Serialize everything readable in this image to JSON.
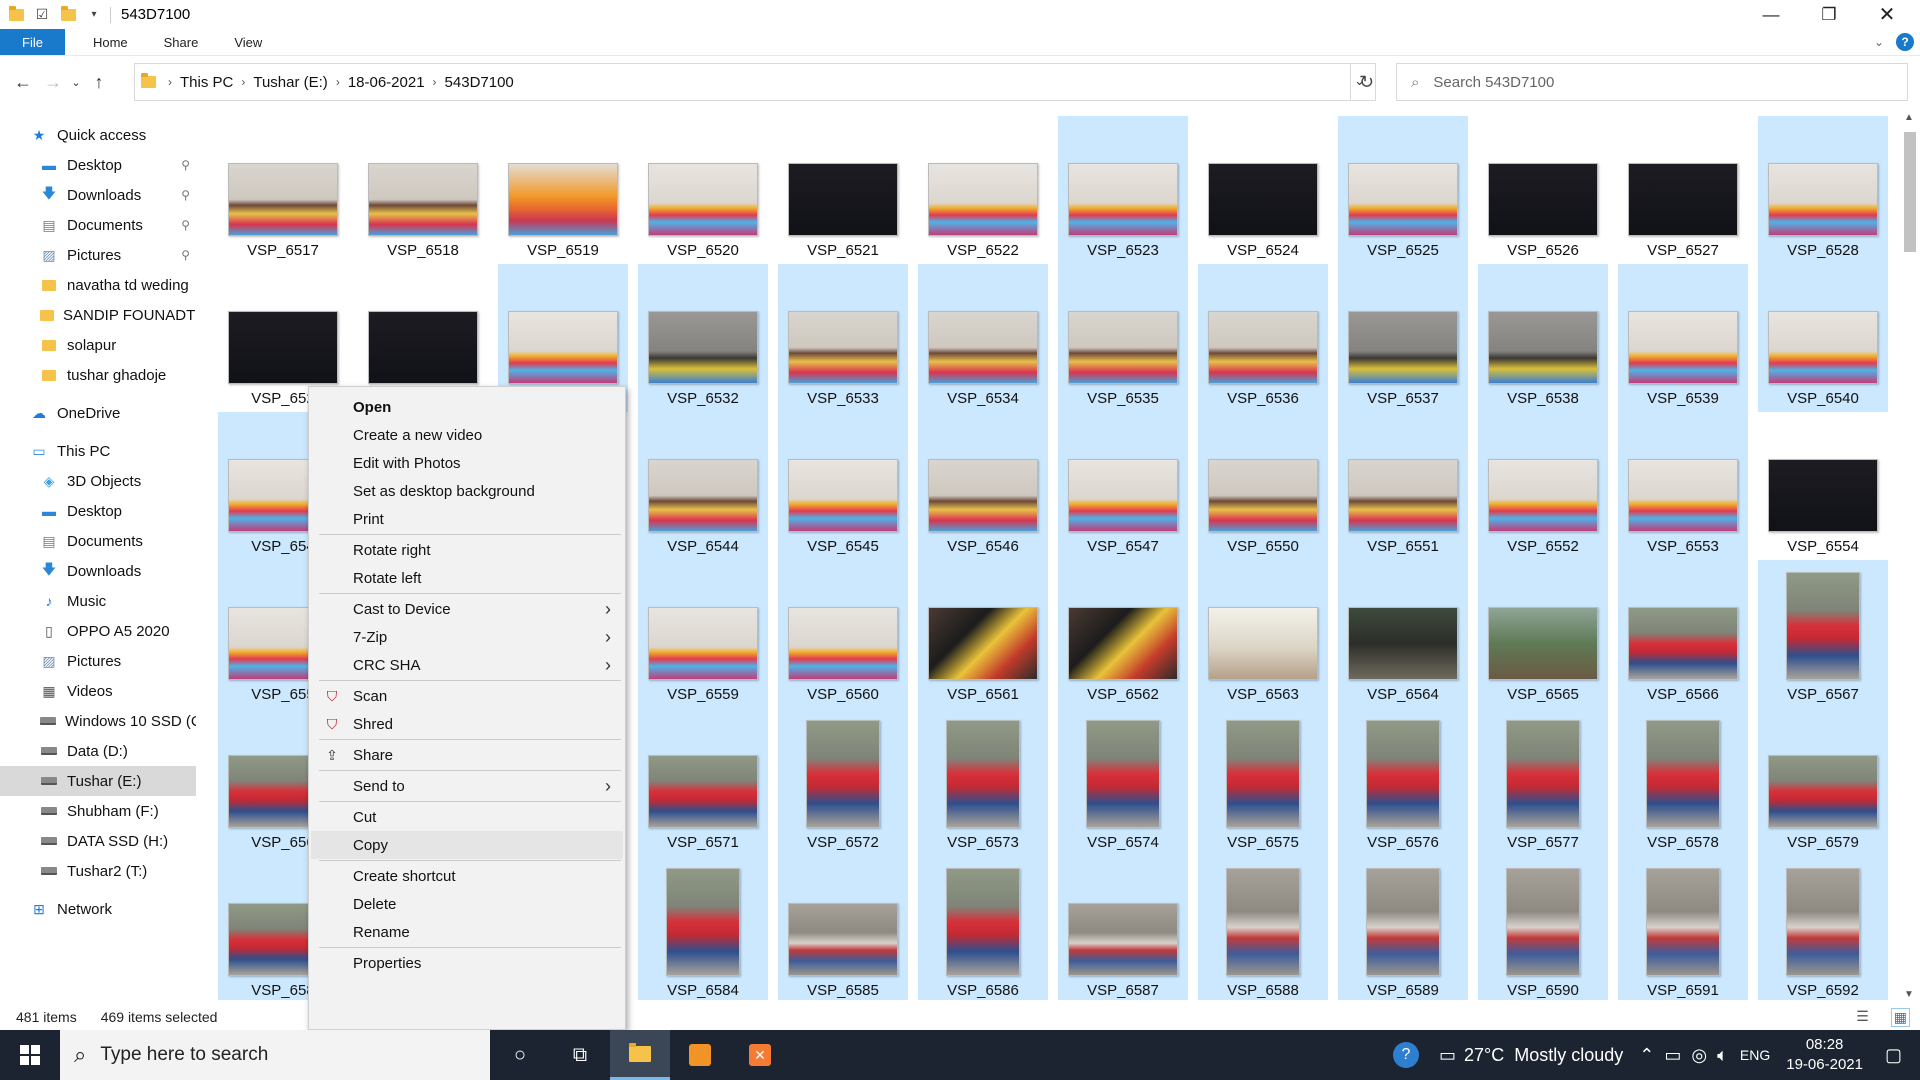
{
  "window": {
    "title": "543D7100"
  },
  "ribbon": {
    "tabs": [
      "File",
      "Home",
      "Share",
      "View"
    ],
    "help": "?"
  },
  "address": {
    "path": [
      "This PC",
      "Tushar (E:)",
      "18-06-2021",
      "543D7100"
    ],
    "search_placeholder": "Search 543D7100"
  },
  "sidebar": {
    "items": [
      {
        "label": "Quick access",
        "icon": "star-icon",
        "indent": 0
      },
      {
        "label": "Desktop",
        "icon": "desktop-icon",
        "indent": 1,
        "pinned": true
      },
      {
        "label": "Downloads",
        "icon": "download-arrow-icon",
        "indent": 1,
        "pinned": true
      },
      {
        "label": "Documents",
        "icon": "document-icon",
        "indent": 1,
        "pinned": true
      },
      {
        "label": "Pictures",
        "icon": "picture-icon",
        "indent": 1,
        "pinned": true
      },
      {
        "label": "navatha td weding",
        "icon": "folder-icon",
        "indent": 1
      },
      {
        "label": "SANDIP FOUNADTI(",
        "icon": "folder-icon",
        "indent": 1
      },
      {
        "label": "solapur",
        "icon": "folder-icon",
        "indent": 1
      },
      {
        "label": "tushar ghadoje",
        "icon": "folder-icon",
        "indent": 1
      },
      {
        "label": "OneDrive",
        "icon": "cloud-icon",
        "indent": 0,
        "gap": true
      },
      {
        "label": "This PC",
        "icon": "computer-icon",
        "indent": 0,
        "gap": true
      },
      {
        "label": "3D Objects",
        "icon": "cube-icon",
        "indent": 1
      },
      {
        "label": "Desktop",
        "icon": "desktop-icon",
        "indent": 1
      },
      {
        "label": "Documents",
        "icon": "document-icon",
        "indent": 1
      },
      {
        "label": "Downloads",
        "icon": "download-arrow-icon",
        "indent": 1
      },
      {
        "label": "Music",
        "icon": "music-note-icon",
        "indent": 1
      },
      {
        "label": "OPPO A5 2020",
        "icon": "phone-icon",
        "indent": 1
      },
      {
        "label": "Pictures",
        "icon": "picture-icon",
        "indent": 1
      },
      {
        "label": "Videos",
        "icon": "film-icon",
        "indent": 1
      },
      {
        "label": "Windows 10 SSD (C",
        "icon": "windows-drive-icon",
        "indent": 1
      },
      {
        "label": "Data (D:)",
        "icon": "drive-icon",
        "indent": 1
      },
      {
        "label": "Tushar (E:)",
        "icon": "drive-icon",
        "indent": 1,
        "selected": true
      },
      {
        "label": "Shubham (F:)",
        "icon": "drive-icon",
        "indent": 1
      },
      {
        "label": "DATA SSD (H:)",
        "icon": "drive-icon",
        "indent": 1
      },
      {
        "label": "Tushar2 (T:)",
        "icon": "drive-icon",
        "indent": 1
      },
      {
        "label": "Network",
        "icon": "network-icon",
        "indent": 0,
        "gap": true
      }
    ]
  },
  "files": [
    {
      "name": "VSP_6517",
      "sel": false,
      "tone": "party-kid",
      "portrait": false
    },
    {
      "name": "VSP_6518",
      "sel": false,
      "tone": "party-kid",
      "portrait": false
    },
    {
      "name": "VSP_6519",
      "sel": false,
      "tone": "party-orange",
      "portrait": false
    },
    {
      "name": "VSP_6520",
      "sel": false,
      "tone": "party",
      "portrait": false
    },
    {
      "name": "VSP_6521",
      "sel": false,
      "tone": "dark",
      "portrait": false
    },
    {
      "name": "VSP_6522",
      "sel": false,
      "tone": "party",
      "portrait": false
    },
    {
      "name": "VSP_6523",
      "sel": true,
      "tone": "party",
      "portrait": false
    },
    {
      "name": "VSP_6524",
      "sel": false,
      "tone": "dark",
      "portrait": false
    },
    {
      "name": "VSP_6525",
      "sel": true,
      "tone": "party",
      "portrait": false
    },
    {
      "name": "VSP_6526",
      "sel": false,
      "tone": "dark",
      "portrait": false
    },
    {
      "name": "VSP_6527",
      "sel": false,
      "tone": "dark",
      "portrait": false
    },
    {
      "name": "VSP_6528",
      "sel": true,
      "tone": "party",
      "portrait": false
    },
    {
      "name": "VSP_652",
      "sel": false,
      "tone": "dark",
      "portrait": false
    },
    {
      "name": "",
      "sel": false,
      "tone": "dark",
      "portrait": false
    },
    {
      "name": "",
      "sel": true,
      "tone": "party",
      "portrait": false
    },
    {
      "name": "VSP_6532",
      "sel": true,
      "tone": "grey-kid",
      "portrait": false
    },
    {
      "name": "VSP_6533",
      "sel": true,
      "tone": "party-kid",
      "portrait": false
    },
    {
      "name": "VSP_6534",
      "sel": true,
      "tone": "party-kid",
      "portrait": false
    },
    {
      "name": "VSP_6535",
      "sel": true,
      "tone": "party-kid",
      "portrait": false
    },
    {
      "name": "VSP_6536",
      "sel": true,
      "tone": "party-kid",
      "portrait": false
    },
    {
      "name": "VSP_6537",
      "sel": true,
      "tone": "grey-kid",
      "portrait": false
    },
    {
      "name": "VSP_6538",
      "sel": true,
      "tone": "grey-kid",
      "portrait": false
    },
    {
      "name": "VSP_6539",
      "sel": true,
      "tone": "party",
      "portrait": false
    },
    {
      "name": "VSP_6540",
      "sel": true,
      "tone": "party",
      "portrait": false
    },
    {
      "name": "VSP_654",
      "sel": true,
      "tone": "party",
      "portrait": false
    },
    {
      "name": "",
      "sel": false,
      "tone": "party",
      "portrait": false
    },
    {
      "name": "",
      "sel": false,
      "tone": "party",
      "portrait": false
    },
    {
      "name": "VSP_6544",
      "sel": true,
      "tone": "party-kid",
      "portrait": false
    },
    {
      "name": "VSP_6545",
      "sel": true,
      "tone": "party",
      "portrait": false
    },
    {
      "name": "VSP_6546",
      "sel": true,
      "tone": "party-kid",
      "portrait": false
    },
    {
      "name": "VSP_6547",
      "sel": true,
      "tone": "party",
      "portrait": false
    },
    {
      "name": "VSP_6550",
      "sel": true,
      "tone": "party-kid",
      "portrait": false
    },
    {
      "name": "VSP_6551",
      "sel": true,
      "tone": "party-kid",
      "portrait": false
    },
    {
      "name": "VSP_6552",
      "sel": true,
      "tone": "party",
      "portrait": false
    },
    {
      "name": "VSP_6553",
      "sel": true,
      "tone": "party",
      "portrait": false
    },
    {
      "name": "VSP_6554",
      "sel": false,
      "tone": "dark",
      "portrait": false
    },
    {
      "name": "VSP_655",
      "sel": true,
      "tone": "party",
      "portrait": false
    },
    {
      "name": "",
      "sel": false,
      "tone": "party",
      "portrait": false
    },
    {
      "name": "",
      "sel": false,
      "tone": "party",
      "portrait": false
    },
    {
      "name": "VSP_6559",
      "sel": true,
      "tone": "party",
      "portrait": false
    },
    {
      "name": "VSP_6560",
      "sel": true,
      "tone": "party",
      "portrait": false
    },
    {
      "name": "VSP_6561",
      "sel": true,
      "tone": "people",
      "portrait": false
    },
    {
      "name": "VSP_6562",
      "sel": true,
      "tone": "people",
      "portrait": false
    },
    {
      "name": "VSP_6563",
      "sel": true,
      "tone": "outdoor-light",
      "portrait": false
    },
    {
      "name": "VSP_6564",
      "sel": true,
      "tone": "outdoor-dark",
      "portrait": false
    },
    {
      "name": "VSP_6565",
      "sel": true,
      "tone": "garden",
      "portrait": false
    },
    {
      "name": "VSP_6566",
      "sel": true,
      "tone": "kid-red",
      "portrait": false
    },
    {
      "name": "VSP_6567",
      "sel": true,
      "tone": "kid-red",
      "portrait": true
    },
    {
      "name": "VSP_656",
      "sel": true,
      "tone": "kid-red",
      "portrait": false
    },
    {
      "name": "",
      "sel": false,
      "tone": "kid-red",
      "portrait": false
    },
    {
      "name": "",
      "sel": false,
      "tone": "kid-red",
      "portrait": false
    },
    {
      "name": "VSP_6571",
      "sel": true,
      "tone": "kid-red",
      "portrait": false
    },
    {
      "name": "VSP_6572",
      "sel": true,
      "tone": "kid-red",
      "portrait": true
    },
    {
      "name": "VSP_6573",
      "sel": true,
      "tone": "kid-red",
      "portrait": true
    },
    {
      "name": "VSP_6574",
      "sel": true,
      "tone": "kid-red",
      "portrait": true
    },
    {
      "name": "VSP_6575",
      "sel": true,
      "tone": "kid-red",
      "portrait": true
    },
    {
      "name": "VSP_6576",
      "sel": true,
      "tone": "kid-red",
      "portrait": true
    },
    {
      "name": "VSP_6577",
      "sel": true,
      "tone": "kid-red",
      "portrait": true
    },
    {
      "name": "VSP_6578",
      "sel": true,
      "tone": "kid-red",
      "portrait": true
    },
    {
      "name": "VSP_6579",
      "sel": true,
      "tone": "kid-red",
      "portrait": false
    },
    {
      "name": "VSP_658",
      "sel": true,
      "tone": "kid-red",
      "portrait": false
    },
    {
      "name": "",
      "sel": false,
      "tone": "kid-red",
      "portrait": false
    },
    {
      "name": "",
      "sel": false,
      "tone": "kid-red",
      "portrait": false
    },
    {
      "name": "VSP_6584",
      "sel": true,
      "tone": "kid-red",
      "portrait": true
    },
    {
      "name": "VSP_6585",
      "sel": true,
      "tone": "kid-grey",
      "portrait": false
    },
    {
      "name": "VSP_6586",
      "sel": true,
      "tone": "kid-red",
      "portrait": true
    },
    {
      "name": "VSP_6587",
      "sel": true,
      "tone": "kid-grey",
      "portrait": false
    },
    {
      "name": "VSP_6588",
      "sel": true,
      "tone": "kid-grey",
      "portrait": true
    },
    {
      "name": "VSP_6589",
      "sel": true,
      "tone": "kid-grey",
      "portrait": true
    },
    {
      "name": "VSP_6590",
      "sel": true,
      "tone": "kid-grey",
      "portrait": true
    },
    {
      "name": "VSP_6591",
      "sel": true,
      "tone": "kid-grey",
      "portrait": true
    },
    {
      "name": "VSP_6592",
      "sel": true,
      "tone": "kid-grey",
      "portrait": true
    }
  ],
  "context_menu": {
    "items": [
      {
        "label": "Open",
        "bold": true
      },
      {
        "label": "Create a new video"
      },
      {
        "label": "Edit with Photos"
      },
      {
        "label": "Set as desktop background"
      },
      {
        "label": "Print"
      },
      {
        "sep": true
      },
      {
        "label": "Rotate right"
      },
      {
        "label": "Rotate left"
      },
      {
        "sep": true
      },
      {
        "label": "Cast to Device",
        "submenu": true
      },
      {
        "label": "7-Zip",
        "submenu": true
      },
      {
        "label": "CRC SHA",
        "submenu": true
      },
      {
        "sep": true
      },
      {
        "label": "Scan",
        "icon": "mcafee-shield-icon"
      },
      {
        "label": "Shred",
        "icon": "mcafee-shield-icon"
      },
      {
        "sep": true
      },
      {
        "label": "Share",
        "icon": "share-icon"
      },
      {
        "sep": true
      },
      {
        "label": "Send to",
        "submenu": true
      },
      {
        "sep": true
      },
      {
        "label": "Cut"
      },
      {
        "label": "Copy",
        "highlighted": true
      },
      {
        "sep": true
      },
      {
        "label": "Create shortcut"
      },
      {
        "label": "Delete"
      },
      {
        "label": "Rename"
      },
      {
        "sep": true
      },
      {
        "label": "Properties"
      }
    ]
  },
  "status": {
    "count": "481 items",
    "selected": "469 items selected"
  },
  "taskbar": {
    "search_placeholder": "Type here to search",
    "weather": "27°C  Mostly cloudy",
    "lang": "ENG",
    "time": "08:28",
    "date": "19-06-2021"
  },
  "colors": {
    "accent": "#1979ca",
    "selection": "#cce8ff",
    "taskbar": "#1b2430"
  }
}
